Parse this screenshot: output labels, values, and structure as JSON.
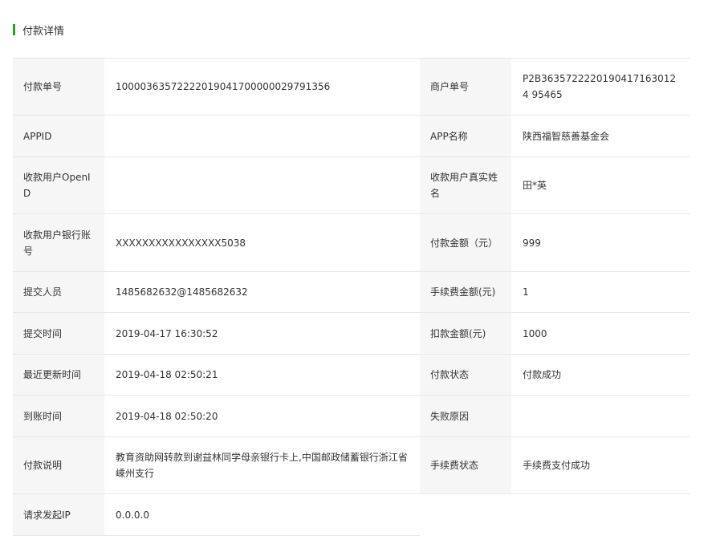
{
  "section": {
    "title": "付款详情"
  },
  "rows": [
    {
      "label_left": "付款单号",
      "value_left": "10000363572222019041700000029791356",
      "label_right": "商户单号",
      "value_right": "P2B36357222201904171630124 95465"
    },
    {
      "label_left": "APPID",
      "value_left": "",
      "label_right": "APP名称",
      "value_right": "陕西福智慈善基金会"
    },
    {
      "label_left": "收款用户OpenID",
      "value_left": "",
      "label_right": "收款用户真实姓名",
      "value_right": "田*英"
    },
    {
      "label_left": "收款用户银行账号",
      "value_left": "XXXXXXXXXXXXXXXX5038",
      "label_right": "付款金额（元）",
      "value_right": "999"
    },
    {
      "label_left": "提交人员",
      "value_left": "1485682632@1485682632",
      "label_right": "手续费金额(元)",
      "value_right": "1"
    },
    {
      "label_left": "提交时间",
      "value_left": "2019-04-17 16:30:52",
      "label_right": "扣款金额(元)",
      "value_right": "1000"
    },
    {
      "label_left": "最近更新时间",
      "value_left": "2019-04-18 02:50:21",
      "label_right": "付款状态",
      "value_right": "付款成功"
    },
    {
      "label_left": "到账时间",
      "value_left": "2019-04-18 02:50:20",
      "label_right": "失败原因",
      "value_right": ""
    },
    {
      "label_left": "付款说明",
      "value_left": "教育资助网转款到谢益林同学母亲银行卡上,中国邮政储蓄银行浙江省嵊州支行",
      "label_right": "手续费状态",
      "value_right": "手续费支付成功"
    },
    {
      "label_left": "请求发起IP",
      "value_left": "0.0.0.0"
    }
  ],
  "colors": {
    "accent": "#1aad19",
    "label_bg": "#f6f6f6",
    "border": "#e7e7e7"
  }
}
